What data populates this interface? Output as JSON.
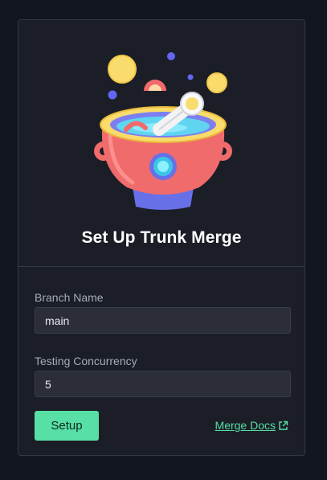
{
  "title": "Set Up Trunk Merge",
  "form": {
    "branch_label": "Branch Name",
    "branch_value": "main",
    "concurrency_label": "Testing Concurrency",
    "concurrency_value": "5"
  },
  "actions": {
    "setup_label": "Setup",
    "docs_label": "Merge Docs",
    "docs_icon": "external-link-icon"
  },
  "illustration": {
    "icon": "bubbling-cauldron-icon"
  },
  "colors": {
    "accent": "#57dfa5",
    "background": "#121620",
    "card": "#1b1e27"
  }
}
